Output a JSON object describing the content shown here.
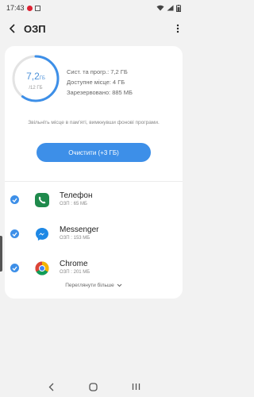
{
  "status_bar": {
    "time": "17:43"
  },
  "header": {
    "title": "ОЗП"
  },
  "memory": {
    "used_value": "7,2",
    "used_unit": "ГБ",
    "total": "/12 ГБ",
    "used_fraction": 0.6,
    "system_line": "Сист. та прогр.: 7,2 ГБ",
    "available_line": "Доступне місце: 4 ГБ",
    "reserved_line": "Зарезервовано: 885 МБ"
  },
  "hint": "Звільніть місце в пам'яті, вимкнувши фонові програми.",
  "clean_button": "Очистити (+3 ГБ)",
  "apps": [
    {
      "name": "Телефон",
      "usage": "ОЗП : 65 МБ",
      "icon": "phone-icon",
      "checked": true
    },
    {
      "name": "Messenger",
      "usage": "ОЗП : 153 МБ",
      "icon": "messenger-icon",
      "checked": true
    },
    {
      "name": "Chrome",
      "usage": "ОЗП : 201 МБ",
      "icon": "chrome-icon",
      "checked": true
    }
  ],
  "view_more": "Переглянути більше",
  "colors": {
    "accent": "#3d8fe8",
    "ring_track": "#e3e3e3",
    "phone_green": "#1f8a4c"
  }
}
